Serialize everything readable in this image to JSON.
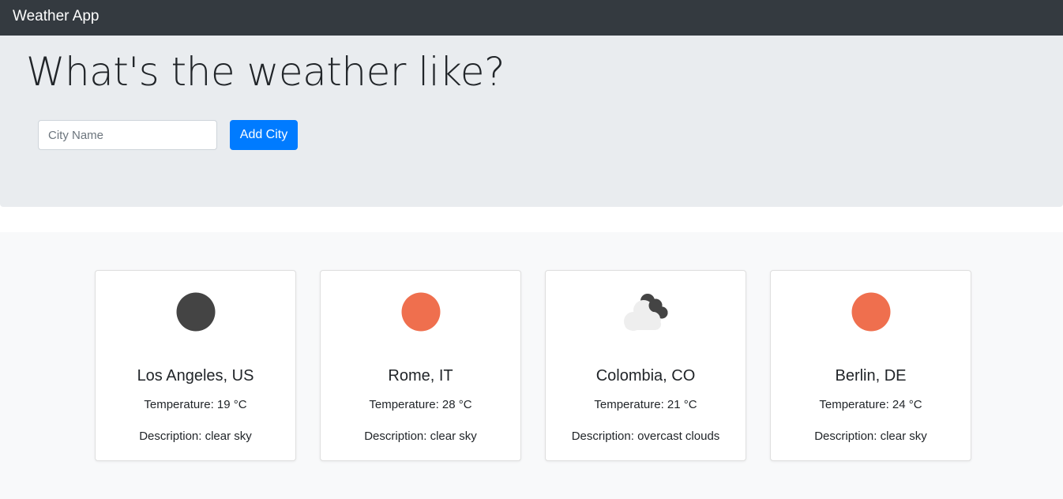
{
  "navbar": {
    "brand": "Weather App"
  },
  "hero": {
    "headline": "What's the weather like?",
    "city_input": {
      "placeholder": "City Name",
      "value": ""
    },
    "add_button_label": "Add City"
  },
  "cities": [
    {
      "name": "Los Angeles, US",
      "temperature": "Temperature: 19 °C",
      "description": "Description: clear sky",
      "icon": "clear-night-icon",
      "icon_color": "#444444"
    },
    {
      "name": "Rome, IT",
      "temperature": "Temperature: 28 °C",
      "description": "Description: clear sky",
      "icon": "sun-icon",
      "icon_color": "#ef6f4e"
    },
    {
      "name": "Colombia, CO",
      "temperature": "Temperature: 21 °C",
      "description": "Description: overcast clouds",
      "icon": "cloud-icon",
      "icon_color": "#444444"
    },
    {
      "name": "Berlin, DE",
      "temperature": "Temperature: 24 °C",
      "description": "Description: clear sky",
      "icon": "sun-icon",
      "icon_color": "#ef6f4e"
    }
  ],
  "colors": {
    "navbar_bg": "#343a40",
    "hero_bg": "#e9ecef",
    "section_bg": "#f8f9fa",
    "primary": "#007bff"
  }
}
